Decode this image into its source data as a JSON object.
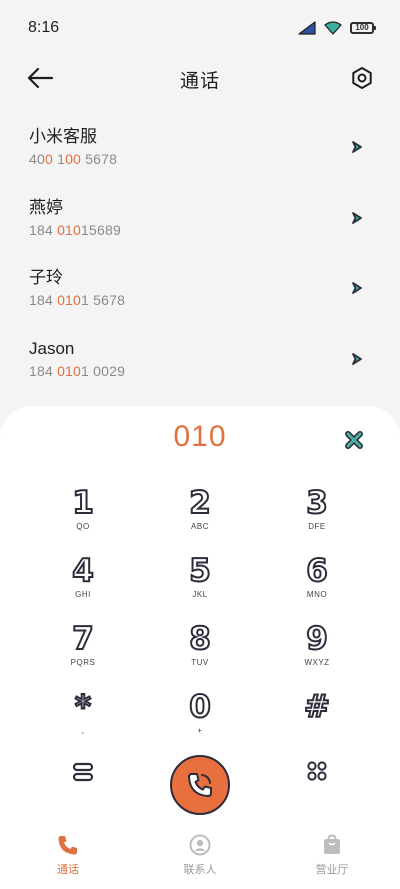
{
  "status": {
    "time": "8:16",
    "battery": "100"
  },
  "header": {
    "title": "通话"
  },
  "contacts": [
    {
      "name": "小米客服",
      "number_pre": "40",
      "number_hl1": "0",
      "number_mid": " 1",
      "number_hl2": "00",
      "number_post": " 5678"
    },
    {
      "name": "燕婷",
      "number_pre": "184 ",
      "number_hl1": "010",
      "number_mid": "",
      "number_hl2": "",
      "number_post": "15689"
    },
    {
      "name": "子玲",
      "number_pre": "184 ",
      "number_hl1": "010",
      "number_mid": "",
      "number_hl2": "",
      "number_post": "1 5678"
    },
    {
      "name": "Jason",
      "number_pre": "184 ",
      "number_hl1": "010",
      "number_mid": "",
      "number_hl2": "",
      "number_post": "1 0029"
    }
  ],
  "dialer": {
    "number": "010",
    "keys": [
      {
        "digit": "1",
        "letters": "QO"
      },
      {
        "digit": "2",
        "letters": "ABC"
      },
      {
        "digit": "3",
        "letters": "DFE"
      },
      {
        "digit": "4",
        "letters": "GHI"
      },
      {
        "digit": "5",
        "letters": "JKL"
      },
      {
        "digit": "6",
        "letters": "MNO"
      },
      {
        "digit": "7",
        "letters": "PQRS"
      },
      {
        "digit": "8",
        "letters": "TUV"
      },
      {
        "digit": "9",
        "letters": "WXYZ"
      },
      {
        "digit": "*",
        "letters": ","
      },
      {
        "digit": "0",
        "letters": "+"
      },
      {
        "digit": "#",
        "letters": ""
      }
    ]
  },
  "nav": {
    "calls": "通话",
    "contacts": "联系人",
    "hall": "营业厅"
  },
  "colors": {
    "accent": "#e07140",
    "outline": "#2c2c3a",
    "teal": "#4cae9f",
    "sheet": "#ffffff",
    "background": "#f4f4f4"
  }
}
